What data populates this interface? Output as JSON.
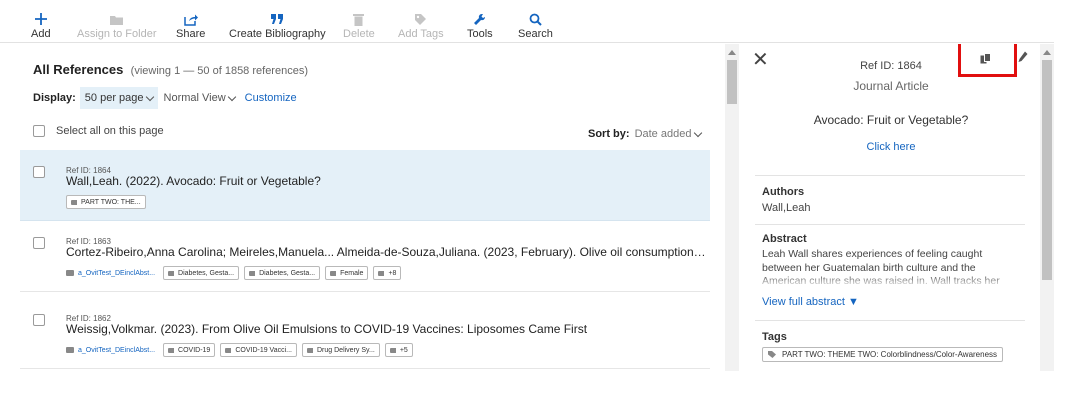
{
  "toolbar": {
    "add": "Add",
    "assign_folder": "Assign to Folder",
    "share": "Share",
    "bibliography": "Create Bibliography",
    "delete": "Delete",
    "add_tags": "Add Tags",
    "tools": "Tools",
    "search": "Search"
  },
  "list": {
    "heading": "All References",
    "viewing": "(viewing 1 — 50 of 1858 references)",
    "display_label": "Display:",
    "per_page": "50 per page",
    "view_mode": "Normal View",
    "customize": "Customize",
    "select_all": "Select all on this page",
    "sort_label": "Sort by:",
    "sort_value": "Date added",
    "rows": [
      {
        "refid": "Ref ID: 1864",
        "citation": "Wall,Leah. (2022). Avocado: Fruit or Vegetable?",
        "folder": "",
        "tags": [
          "PART TWO: THE..."
        ],
        "more": ""
      },
      {
        "refid": "Ref ID: 1863",
        "citation": "Cortez-Ribeiro,Anna Carolina; Meireles,Manuela... Almeida-de-Souza,Juliana. (2023, February). Olive oil consumption ...",
        "folder": "a_OvitTest_DEinclAbst...",
        "tags": [
          "Diabetes, Gesta...",
          "Diabetes, Gesta...",
          "Female"
        ],
        "more": "+8"
      },
      {
        "refid": "Ref ID: 1862",
        "citation": "Weissig,Volkmar. (2023). From Olive Oil Emulsions to COVID-19 Vaccines: Liposomes Came First",
        "folder": "a_OvitTest_DEinclAbst...",
        "tags": [
          "COVID-19",
          "COVID-19 Vacci...",
          "Drug Delivery Sy..."
        ],
        "more": "+5"
      }
    ]
  },
  "detail": {
    "refid": "Ref ID: 1864",
    "type": "Journal Article",
    "title": "Avocado: Fruit or Vegetable?",
    "link": "Click here",
    "authors_label": "Authors",
    "authors": "Wall,Leah",
    "abstract_label": "Abstract",
    "abstract": "Leah Wall shares experiences of feeling caught between her Guatemalan birth culture and the American culture she was raised in. Wall tracks her",
    "view_full": "View full abstract ▼",
    "tags_label": "Tags",
    "tag": "PART TWO: THEME TWO: Colorblindness/Color-Awareness"
  },
  "colors": {
    "accent": "#1565c0",
    "selected_row": "#e4f0f8",
    "highlight_box": "#e10f0f"
  }
}
